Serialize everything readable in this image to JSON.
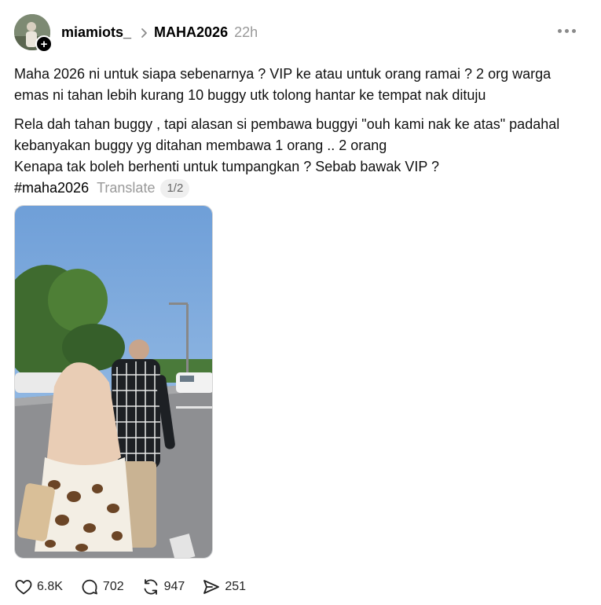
{
  "post": {
    "author": "miamiots_",
    "community": "MAHA2026",
    "time": "22h",
    "paragraph1": [
      "Maha 2026 ni untuk siapa sebenarnya ? VIP ke atau untuk orang ramai ? 2 org warga",
      "emas ni tahan lebih kurang 10 buggy utk tolong hantar ke tempat nak dituju"
    ],
    "paragraph2": [
      "Rela dah tahan buggy , tapi alasan si pembawa buggyi \"ouh kami nak ke atas\" padahal",
      "kebanyakan buggy yg ditahan membawa 1 orang .. 2 orang",
      "Kenapa tak boleh berhenti untuk tumpangkan ? Sebab bawak VIP ?"
    ],
    "hashtag": "#maha2026",
    "translate_label": "Translate",
    "media_counter": "1/2"
  },
  "actions": {
    "likes": "6.8K",
    "comments": "702",
    "reposts": "947",
    "shares": "251"
  },
  "icons": [
    "follow-plus-icon",
    "chevron-right-icon",
    "more-icon",
    "heart-icon",
    "comment-icon",
    "repost-icon",
    "share-icon"
  ]
}
